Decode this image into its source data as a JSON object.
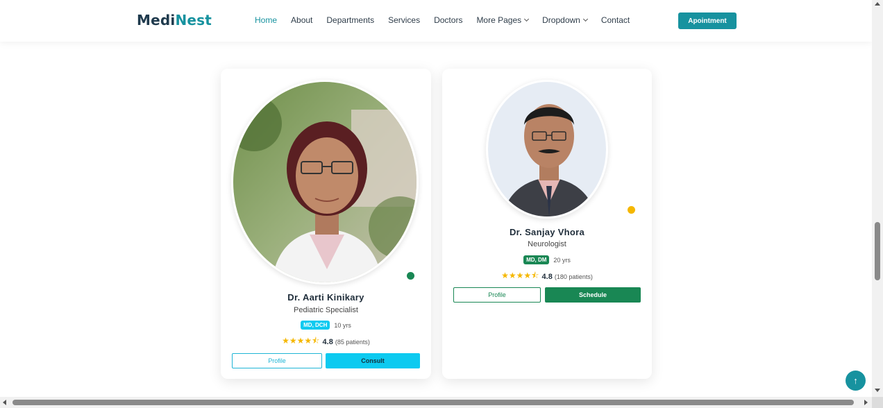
{
  "header": {
    "logo_part1": "Medi",
    "logo_part2": "Nest",
    "nav": [
      {
        "label": "Home",
        "active": true
      },
      {
        "label": "About"
      },
      {
        "label": "Departments"
      },
      {
        "label": "Services"
      },
      {
        "label": "Doctors"
      },
      {
        "label": "More Pages",
        "dropdown": true
      },
      {
        "label": "Dropdown",
        "dropdown": true
      },
      {
        "label": "Contact"
      }
    ],
    "cta_label": "Apointment"
  },
  "doctors": [
    {
      "name": "Dr. Aarti Kinikary",
      "specialty": "Pediatric Specialist",
      "degree": "MD, DCH",
      "experience": "10 yrs",
      "rating": "4.8",
      "rating_value": 4.5,
      "patients": "(85 patients)",
      "status_color": "#198754",
      "badge_color": "#0dcaf0",
      "profile_label": "Profile",
      "action_label": "Consult"
    },
    {
      "name": "Dr. Sanjay Vhora",
      "specialty": "Neurologist",
      "degree": "MD, DM",
      "experience": "20 yrs",
      "rating": "4.8",
      "rating_value": 4.5,
      "patients": "(180 patients)",
      "status_color": "#f5b700",
      "badge_color": "#198754",
      "profile_label": "Profile",
      "action_label": "Schedule"
    }
  ],
  "scroll_top_icon": "arrow-up-icon",
  "colors": {
    "brand": "#17929f",
    "info": "#0dcaf0",
    "success": "#198754",
    "warning": "#f5b700"
  }
}
